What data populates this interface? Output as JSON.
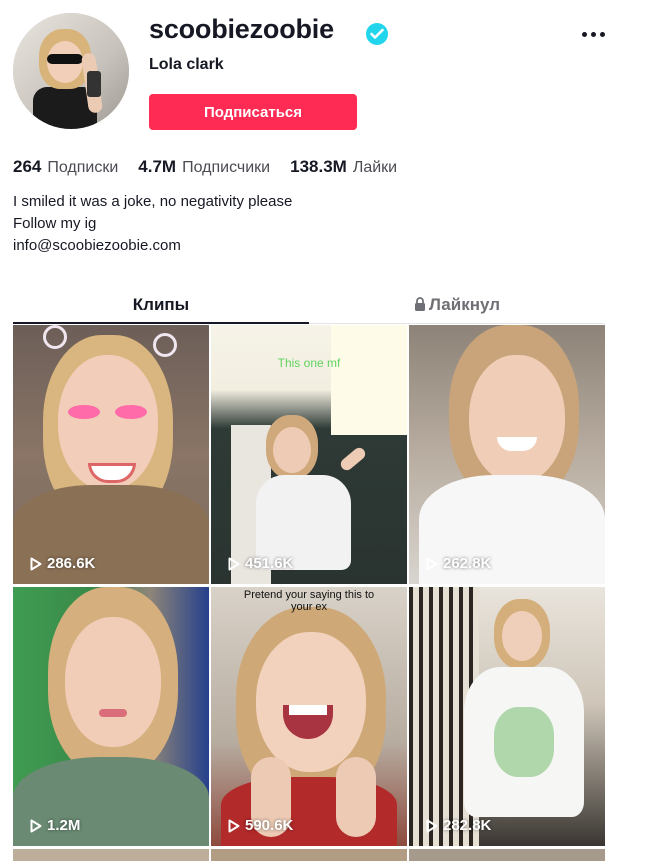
{
  "profile": {
    "username": "scoobiezoobie",
    "nickname": "Lola clark",
    "follow_label": "Подписаться",
    "verified_icon": "verified-badge-icon",
    "colors": {
      "accent": "#fe2c55",
      "verified": "#20d5ec"
    }
  },
  "stats": [
    {
      "value": "264",
      "label": "Подписки"
    },
    {
      "value": "4.7M",
      "label": "Подписчики"
    },
    {
      "value": "138.3M",
      "label": "Лайки"
    }
  ],
  "bio": {
    "line1": "I smiled it was a joke, no negativity please",
    "line2": "Follow my ig",
    "line3": "info@scoobiezoobie.com"
  },
  "tabs": {
    "videos": "Клипы",
    "liked": "Лайкнул"
  },
  "videos": [
    {
      "views": "286.6K",
      "caption": ""
    },
    {
      "views": "451.6K",
      "caption": "This one mf"
    },
    {
      "views": "262.8K",
      "caption": ""
    },
    {
      "views": "1.2M",
      "caption": ""
    },
    {
      "views": "590.6K",
      "caption": "Pretend your saying this to your ex"
    },
    {
      "views": "282.8K",
      "caption": ""
    }
  ]
}
